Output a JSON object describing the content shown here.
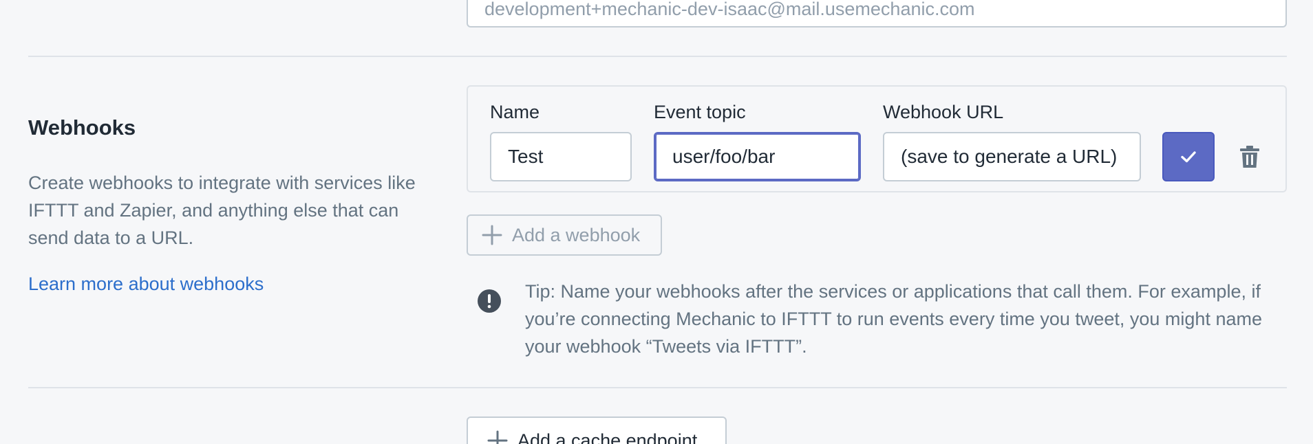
{
  "email_field": {
    "value": "development+mechanic-dev-isaac@mail.usemechanic.com"
  },
  "webhooks_section": {
    "title": "Webhooks",
    "description": "Create webhooks to integrate with services like IFTTT and Zapier, and anything else that can send data to a URL.",
    "learn_more_link": "Learn more about webhooks"
  },
  "webhook_row": {
    "name_label": "Name",
    "name_value": "Test",
    "event_topic_label": "Event topic",
    "event_topic_value": "user/foo/bar",
    "url_label": "Webhook URL",
    "url_value": "(save to generate a URL)",
    "confirm_icon": "checkmark-icon",
    "delete_icon": "trash-icon"
  },
  "add_webhook_button": {
    "label": "Add a webhook",
    "icon": "plus-icon"
  },
  "tip": {
    "icon": "exclamation-circle-icon",
    "text": "Tip: Name your webhooks after the services or applications that call them. For example, if you’re connecting Mechanic to IFTTT to run events every time you tweet, you might name your webhook “Tweets via IFTTT”."
  },
  "add_cache_button": {
    "label": "Add a cache endpoint",
    "icon": "plus-icon"
  },
  "colors": {
    "accent": "#5c6ac4",
    "link": "#2c6ecb",
    "muted_text": "#637381",
    "disabled_text": "#919eab",
    "background": "#f6f7f9"
  }
}
